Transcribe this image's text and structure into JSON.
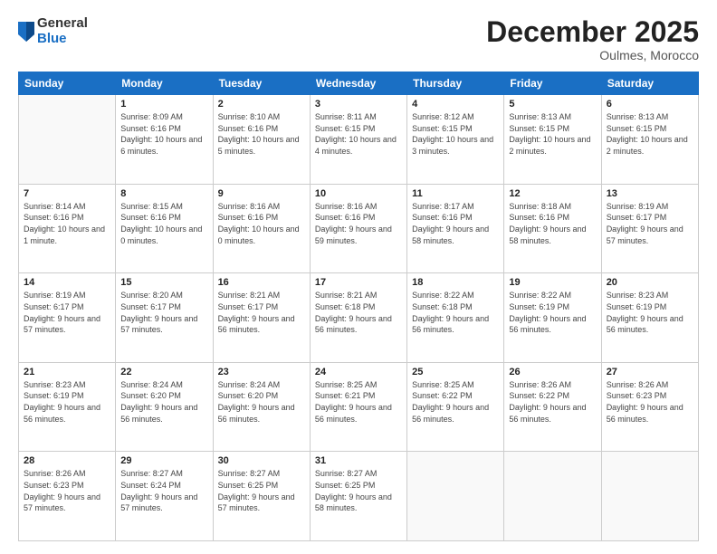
{
  "logo": {
    "general": "General",
    "blue": "Blue"
  },
  "title": "December 2025",
  "location": "Oulmes, Morocco",
  "days_header": [
    "Sunday",
    "Monday",
    "Tuesday",
    "Wednesday",
    "Thursday",
    "Friday",
    "Saturday"
  ],
  "weeks": [
    [
      {
        "day": "",
        "sunrise": "",
        "sunset": "",
        "daylight": ""
      },
      {
        "day": "1",
        "sunrise": "Sunrise: 8:09 AM",
        "sunset": "Sunset: 6:16 PM",
        "daylight": "Daylight: 10 hours and 6 minutes."
      },
      {
        "day": "2",
        "sunrise": "Sunrise: 8:10 AM",
        "sunset": "Sunset: 6:16 PM",
        "daylight": "Daylight: 10 hours and 5 minutes."
      },
      {
        "day": "3",
        "sunrise": "Sunrise: 8:11 AM",
        "sunset": "Sunset: 6:15 PM",
        "daylight": "Daylight: 10 hours and 4 minutes."
      },
      {
        "day": "4",
        "sunrise": "Sunrise: 8:12 AM",
        "sunset": "Sunset: 6:15 PM",
        "daylight": "Daylight: 10 hours and 3 minutes."
      },
      {
        "day": "5",
        "sunrise": "Sunrise: 8:13 AM",
        "sunset": "Sunset: 6:15 PM",
        "daylight": "Daylight: 10 hours and 2 minutes."
      },
      {
        "day": "6",
        "sunrise": "Sunrise: 8:13 AM",
        "sunset": "Sunset: 6:15 PM",
        "daylight": "Daylight: 10 hours and 2 minutes."
      }
    ],
    [
      {
        "day": "7",
        "sunrise": "Sunrise: 8:14 AM",
        "sunset": "Sunset: 6:16 PM",
        "daylight": "Daylight: 10 hours and 1 minute."
      },
      {
        "day": "8",
        "sunrise": "Sunrise: 8:15 AM",
        "sunset": "Sunset: 6:16 PM",
        "daylight": "Daylight: 10 hours and 0 minutes."
      },
      {
        "day": "9",
        "sunrise": "Sunrise: 8:16 AM",
        "sunset": "Sunset: 6:16 PM",
        "daylight": "Daylight: 10 hours and 0 minutes."
      },
      {
        "day": "10",
        "sunrise": "Sunrise: 8:16 AM",
        "sunset": "Sunset: 6:16 PM",
        "daylight": "Daylight: 9 hours and 59 minutes."
      },
      {
        "day": "11",
        "sunrise": "Sunrise: 8:17 AM",
        "sunset": "Sunset: 6:16 PM",
        "daylight": "Daylight: 9 hours and 58 minutes."
      },
      {
        "day": "12",
        "sunrise": "Sunrise: 8:18 AM",
        "sunset": "Sunset: 6:16 PM",
        "daylight": "Daylight: 9 hours and 58 minutes."
      },
      {
        "day": "13",
        "sunrise": "Sunrise: 8:19 AM",
        "sunset": "Sunset: 6:17 PM",
        "daylight": "Daylight: 9 hours and 57 minutes."
      }
    ],
    [
      {
        "day": "14",
        "sunrise": "Sunrise: 8:19 AM",
        "sunset": "Sunset: 6:17 PM",
        "daylight": "Daylight: 9 hours and 57 minutes."
      },
      {
        "day": "15",
        "sunrise": "Sunrise: 8:20 AM",
        "sunset": "Sunset: 6:17 PM",
        "daylight": "Daylight: 9 hours and 57 minutes."
      },
      {
        "day": "16",
        "sunrise": "Sunrise: 8:21 AM",
        "sunset": "Sunset: 6:17 PM",
        "daylight": "Daylight: 9 hours and 56 minutes."
      },
      {
        "day": "17",
        "sunrise": "Sunrise: 8:21 AM",
        "sunset": "Sunset: 6:18 PM",
        "daylight": "Daylight: 9 hours and 56 minutes."
      },
      {
        "day": "18",
        "sunrise": "Sunrise: 8:22 AM",
        "sunset": "Sunset: 6:18 PM",
        "daylight": "Daylight: 9 hours and 56 minutes."
      },
      {
        "day": "19",
        "sunrise": "Sunrise: 8:22 AM",
        "sunset": "Sunset: 6:19 PM",
        "daylight": "Daylight: 9 hours and 56 minutes."
      },
      {
        "day": "20",
        "sunrise": "Sunrise: 8:23 AM",
        "sunset": "Sunset: 6:19 PM",
        "daylight": "Daylight: 9 hours and 56 minutes."
      }
    ],
    [
      {
        "day": "21",
        "sunrise": "Sunrise: 8:23 AM",
        "sunset": "Sunset: 6:19 PM",
        "daylight": "Daylight: 9 hours and 56 minutes."
      },
      {
        "day": "22",
        "sunrise": "Sunrise: 8:24 AM",
        "sunset": "Sunset: 6:20 PM",
        "daylight": "Daylight: 9 hours and 56 minutes."
      },
      {
        "day": "23",
        "sunrise": "Sunrise: 8:24 AM",
        "sunset": "Sunset: 6:20 PM",
        "daylight": "Daylight: 9 hours and 56 minutes."
      },
      {
        "day": "24",
        "sunrise": "Sunrise: 8:25 AM",
        "sunset": "Sunset: 6:21 PM",
        "daylight": "Daylight: 9 hours and 56 minutes."
      },
      {
        "day": "25",
        "sunrise": "Sunrise: 8:25 AM",
        "sunset": "Sunset: 6:22 PM",
        "daylight": "Daylight: 9 hours and 56 minutes."
      },
      {
        "day": "26",
        "sunrise": "Sunrise: 8:26 AM",
        "sunset": "Sunset: 6:22 PM",
        "daylight": "Daylight: 9 hours and 56 minutes."
      },
      {
        "day": "27",
        "sunrise": "Sunrise: 8:26 AM",
        "sunset": "Sunset: 6:23 PM",
        "daylight": "Daylight: 9 hours and 56 minutes."
      }
    ],
    [
      {
        "day": "28",
        "sunrise": "Sunrise: 8:26 AM",
        "sunset": "Sunset: 6:23 PM",
        "daylight": "Daylight: 9 hours and 57 minutes."
      },
      {
        "day": "29",
        "sunrise": "Sunrise: 8:27 AM",
        "sunset": "Sunset: 6:24 PM",
        "daylight": "Daylight: 9 hours and 57 minutes."
      },
      {
        "day": "30",
        "sunrise": "Sunrise: 8:27 AM",
        "sunset": "Sunset: 6:25 PM",
        "daylight": "Daylight: 9 hours and 57 minutes."
      },
      {
        "day": "31",
        "sunrise": "Sunrise: 8:27 AM",
        "sunset": "Sunset: 6:25 PM",
        "daylight": "Daylight: 9 hours and 58 minutes."
      },
      {
        "day": "",
        "sunrise": "",
        "sunset": "",
        "daylight": ""
      },
      {
        "day": "",
        "sunrise": "",
        "sunset": "",
        "daylight": ""
      },
      {
        "day": "",
        "sunrise": "",
        "sunset": "",
        "daylight": ""
      }
    ]
  ]
}
